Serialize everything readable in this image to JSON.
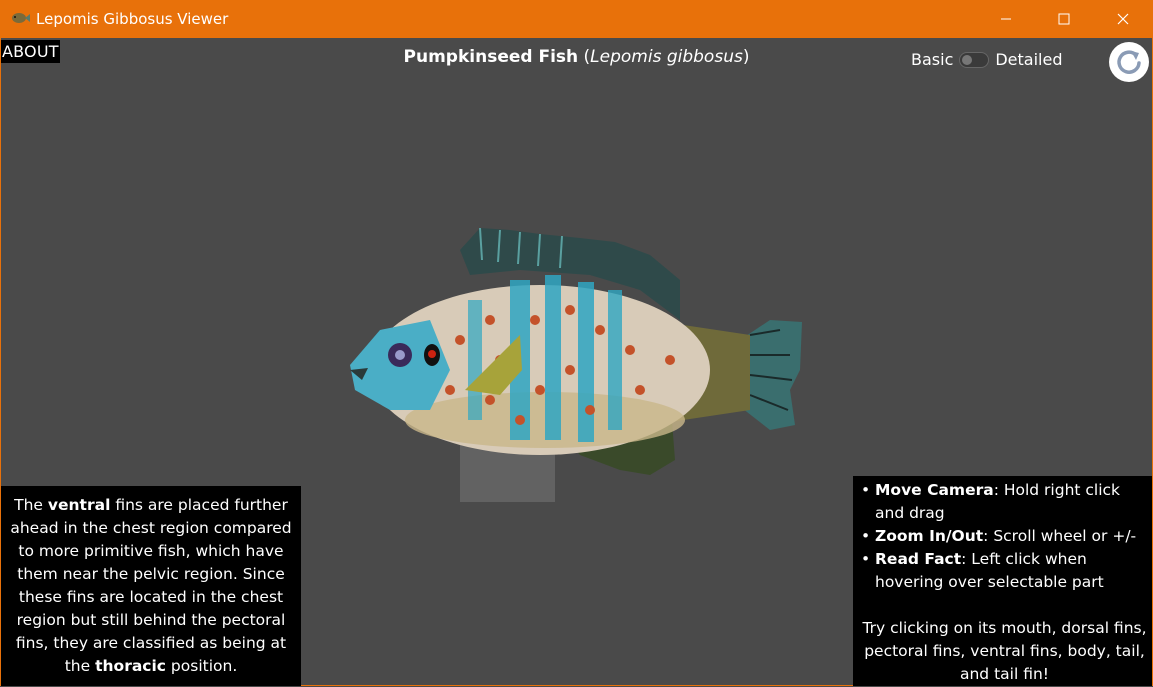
{
  "window": {
    "title": "Lepomis Gibbosus Viewer",
    "accent_color": "#e8710a",
    "icon": "fish-icon"
  },
  "toolbar": {
    "about_label": "ABOUT",
    "title_common": "Pumpkinseed Fish",
    "title_open": "(",
    "title_scientific": "Lepomis gibbosus",
    "title_close": ")",
    "toggle_left_label": "Basic",
    "toggle_right_label": "Detailed",
    "toggle_state": "Basic",
    "reset_icon": "refresh-icon"
  },
  "fact": {
    "p1": "The ",
    "b1": "ventral",
    "p2": " fins are placed further ahead in the chest region compared to more primitive fish, which have them near the pelvic region. Since these fins are located in the chest region but still behind the pectoral fins, they are classified as being at the ",
    "b2": "thoracic",
    "p3": " position."
  },
  "help": {
    "items": [
      {
        "bold": "Move Camera",
        "text": ": Hold right click and drag"
      },
      {
        "bold": "Zoom In/Out",
        "text": ": Scroll wheel or +/-"
      },
      {
        "bold": "Read Fact",
        "text": ": Left click when hovering over selectable part"
      }
    ],
    "footer": "Try clicking on its mouth, dorsal fins, pectoral fins, ventral fins, body, tail, and tail fin!"
  }
}
